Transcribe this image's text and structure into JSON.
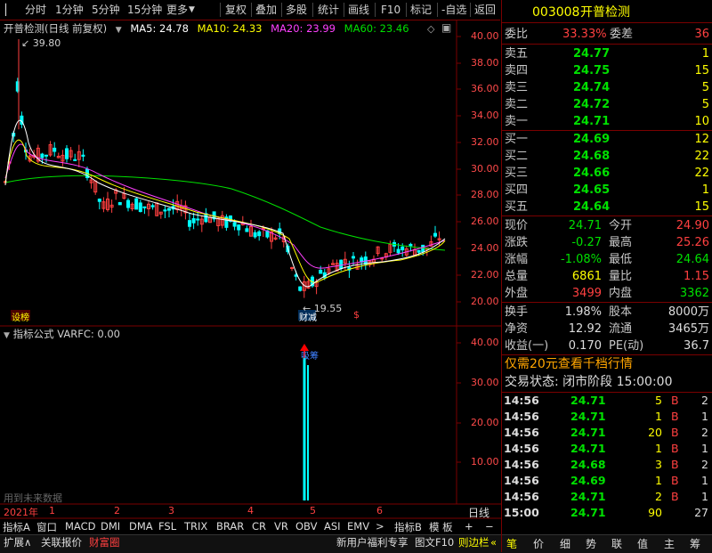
{
  "toolbar": {
    "items": [
      "分时",
      "1分钟",
      "5分钟",
      "15分钟",
      "更多"
    ],
    "right_items": [
      "复权",
      "叠加",
      "多股",
      "统计",
      "画线",
      "F10",
      "标记",
      "-自选",
      "返回"
    ]
  },
  "stock": {
    "code": "003008",
    "name": "开普检测"
  },
  "chart": {
    "title": "开普检测(日线 前复权)",
    "ma": [
      {
        "label": "MA5: 24.78",
        "color": "#ffffff"
      },
      {
        "label": "MA10: 24.33",
        "color": "#ffff00"
      },
      {
        "label": "MA20: 23.99",
        "color": "#ff40ff"
      },
      {
        "label": "MA60: 23.46",
        "color": "#00e000"
      }
    ],
    "high_label": "39.80",
    "low_label": "19.55",
    "price_axis": [
      "40.00",
      "38.00",
      "36.00",
      "34.00",
      "32.00",
      "30.00",
      "28.00",
      "26.00",
      "24.00",
      "22.00",
      "20.00"
    ],
    "mark1": "设榜",
    "mark2": "财减",
    "mark3": "$"
  },
  "indicator": {
    "title": "指标公式 VARFC: 0.00",
    "axis": [
      "40.00",
      "30.00",
      "20.00",
      "10.00"
    ],
    "note": "用到未来数据",
    "signal": "吸筹"
  },
  "timeline": {
    "year": "2021年",
    "months": [
      "1",
      "2",
      "3",
      "4",
      "5",
      "6"
    ],
    "right": "日线"
  },
  "tabs": [
    "指标A",
    "窗口",
    "MACD",
    "DMI",
    "DMA",
    "FSL",
    "TRIX",
    "BRAR",
    "CR",
    "VR",
    "OBV",
    "ASI",
    "EMV",
    ">",
    "指标B",
    "模 板",
    "+",
    "−"
  ],
  "bottom": {
    "left": [
      "扩展∧",
      "关联报价",
      "财富圈"
    ],
    "promo": "新用户福利专享",
    "mid": [
      "图文F10",
      "则边栏"
    ]
  },
  "right_tabs": [
    "笔",
    "价",
    "细",
    "势",
    "联",
    "值",
    "主",
    "筹"
  ],
  "quote": {
    "weibi_label": "委比",
    "weibi": "33.33%",
    "weicha_label": "委差",
    "weicha": "36",
    "asks": [
      {
        "label": "卖五",
        "price": "24.77",
        "vol": "1"
      },
      {
        "label": "卖四",
        "price": "24.75",
        "vol": "15"
      },
      {
        "label": "卖三",
        "price": "24.74",
        "vol": "5"
      },
      {
        "label": "卖二",
        "price": "24.72",
        "vol": "5"
      },
      {
        "label": "卖一",
        "price": "24.71",
        "vol": "10"
      }
    ],
    "bids": [
      {
        "label": "买一",
        "price": "24.69",
        "vol": "12"
      },
      {
        "label": "买二",
        "price": "24.68",
        "vol": "22"
      },
      {
        "label": "买三",
        "price": "24.66",
        "vol": "22"
      },
      {
        "label": "买四",
        "price": "24.65",
        "vol": "1"
      },
      {
        "label": "买五",
        "price": "24.64",
        "vol": "15"
      }
    ],
    "stats": [
      {
        "l1": "现价",
        "v1": "24.71",
        "c1": "#00e000",
        "l2": "今开",
        "v2": "24.90",
        "c2": "#ff4040"
      },
      {
        "l1": "涨跌",
        "v1": "-0.27",
        "c1": "#00e000",
        "l2": "最高",
        "v2": "25.26",
        "c2": "#ff4040"
      },
      {
        "l1": "涨幅",
        "v1": "-1.08%",
        "c1": "#00e000",
        "l2": "最低",
        "v2": "24.64",
        "c2": "#00e000"
      },
      {
        "l1": "总量",
        "v1": "6861",
        "c1": "#ffff00",
        "l2": "量比",
        "v2": "1.15",
        "c2": "#ff4040"
      },
      {
        "l1": "外盘",
        "v1": "3499",
        "c1": "#ff4040",
        "l2": "内盘",
        "v2": "3362",
        "c2": "#00e000"
      }
    ],
    "stats2": [
      {
        "l1": "换手",
        "v1": "1.98%",
        "l2": "股本",
        "v2": "8000万"
      },
      {
        "l1": "净资",
        "v1": "12.92",
        "l2": "流通",
        "v2": "3465万"
      },
      {
        "l1": "收益(一)",
        "v1": "0.170",
        "l2": "PE(动)",
        "v2": "36.7"
      }
    ],
    "promo": "仅需20元查看千档行情",
    "status": "交易状态: 闭市阶段 15:00:00"
  },
  "ticks": [
    {
      "t": "14:56",
      "p": "24.71",
      "v": "5",
      "d": "B",
      "n": "2",
      "vc": "#ffff00"
    },
    {
      "t": "14:56",
      "p": "24.71",
      "v": "1",
      "d": "B",
      "n": "1",
      "vc": "#ffff00"
    },
    {
      "t": "14:56",
      "p": "24.71",
      "v": "20",
      "d": "B",
      "n": "2",
      "vc": "#ffff00"
    },
    {
      "t": "14:56",
      "p": "24.71",
      "v": "1",
      "d": "B",
      "n": "1",
      "vc": "#ffff00"
    },
    {
      "t": "14:56",
      "p": "24.68",
      "v": "3",
      "d": "B",
      "n": "2",
      "vc": "#ffff00"
    },
    {
      "t": "14:56",
      "p": "24.69",
      "v": "1",
      "d": "B",
      "n": "1",
      "vc": "#ffff00"
    },
    {
      "t": "14:56",
      "p": "24.71",
      "v": "2",
      "d": "B",
      "n": "1",
      "vc": "#ffff00"
    },
    {
      "t": "15:00",
      "p": "24.71",
      "v": "90",
      "d": "",
      "n": "27",
      "vc": "#ffff00"
    }
  ]
}
